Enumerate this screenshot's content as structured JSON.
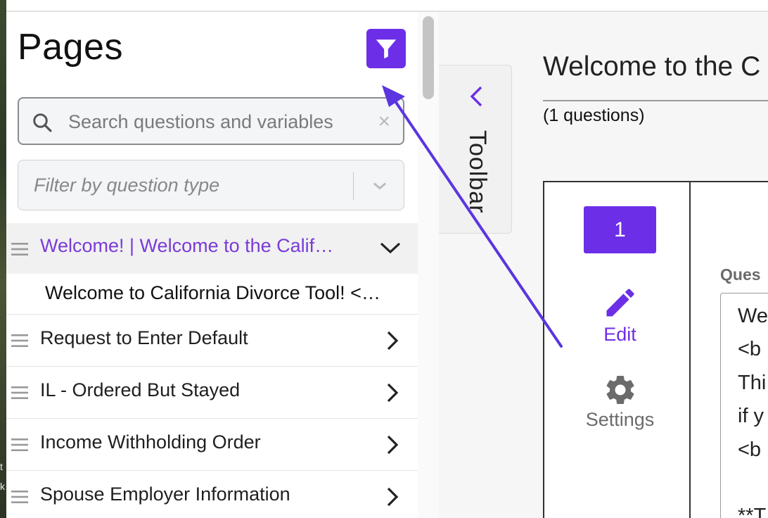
{
  "desktop": {
    "edge_chars": [
      "t",
      "k"
    ]
  },
  "sidebar": {
    "title": "Pages",
    "filter_button_icon": "filter-icon",
    "search": {
      "placeholder": "Search questions and variables",
      "clear_icon": "×"
    },
    "type_filter": {
      "placeholder": "Filter by question type"
    },
    "pages": [
      {
        "label": "Welcome! | Welcome to the Calif…",
        "expanded": true,
        "children": [
          {
            "label": "Welcome to California Divorce Tool! <…"
          }
        ]
      },
      {
        "label": "Request to Enter Default",
        "expanded": false
      },
      {
        "label": "IL - Ordered But Stayed",
        "expanded": false
      },
      {
        "label": "Income Withholding Order",
        "expanded": false
      },
      {
        "label": "Spouse Employer Information",
        "expanded": false
      }
    ]
  },
  "toolbar": {
    "label": "Toolbar"
  },
  "main": {
    "title": "Welcome to the C",
    "question_count": "(1 questions)",
    "card": {
      "number": "1",
      "edit_label": "Edit",
      "settings_label": "Settings",
      "question_label": "Ques",
      "question_lines": [
        "We",
        "<b",
        "Thi",
        "if y",
        "<b",
        "",
        "**T"
      ]
    }
  },
  "colors": {
    "accent": "#6d2ee8",
    "active_text": "#7a3bd8",
    "arrow": "#5b35e0"
  }
}
